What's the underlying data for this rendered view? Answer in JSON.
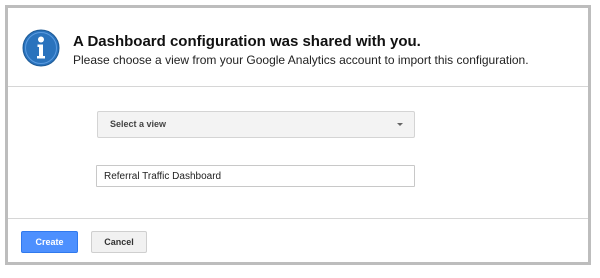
{
  "dialog": {
    "title": "A Dashboard configuration was shared with you.",
    "message": "Please choose a view from your Google Analytics account to import this configuration.",
    "view_select": {
      "selected_label": "Select a view"
    },
    "dashboard_name": {
      "value": "Referral Traffic Dashboard"
    },
    "buttons": {
      "create_label": "Create",
      "cancel_label": "Cancel"
    }
  },
  "icons": {
    "header_icon": "info-icon"
  },
  "colors": {
    "primary_button": "#4d90fe",
    "info_icon": "#2a73bd"
  }
}
